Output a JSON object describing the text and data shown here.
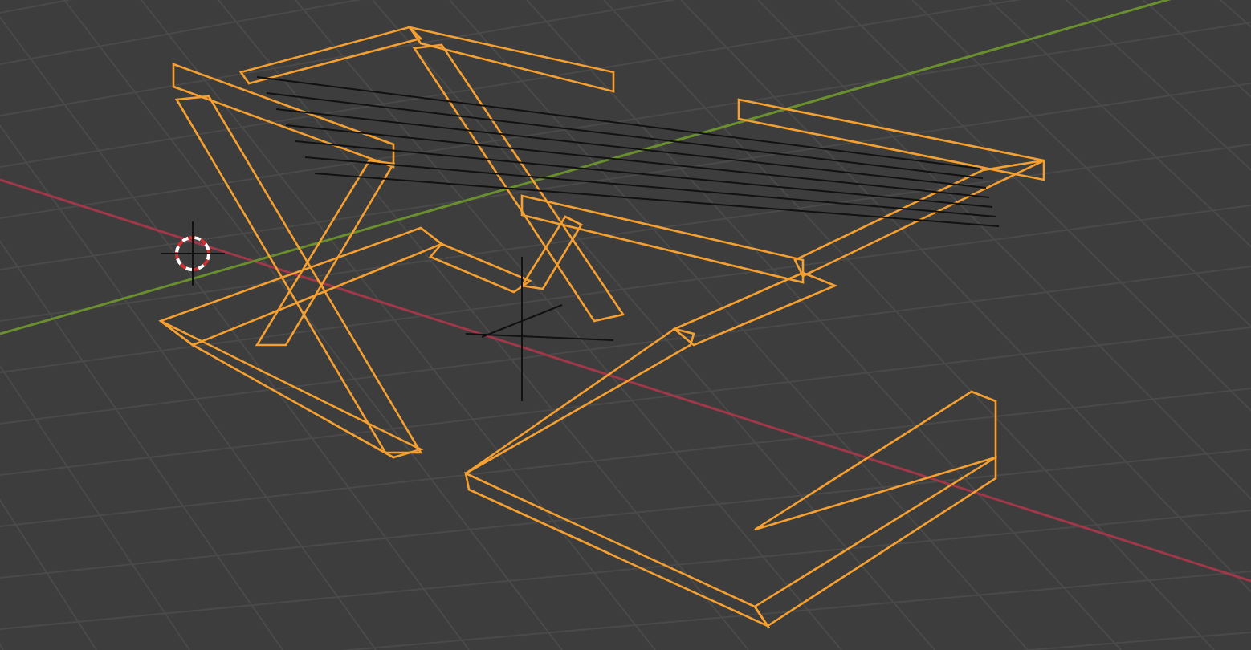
{
  "viewport": {
    "object_selected": true
  }
}
